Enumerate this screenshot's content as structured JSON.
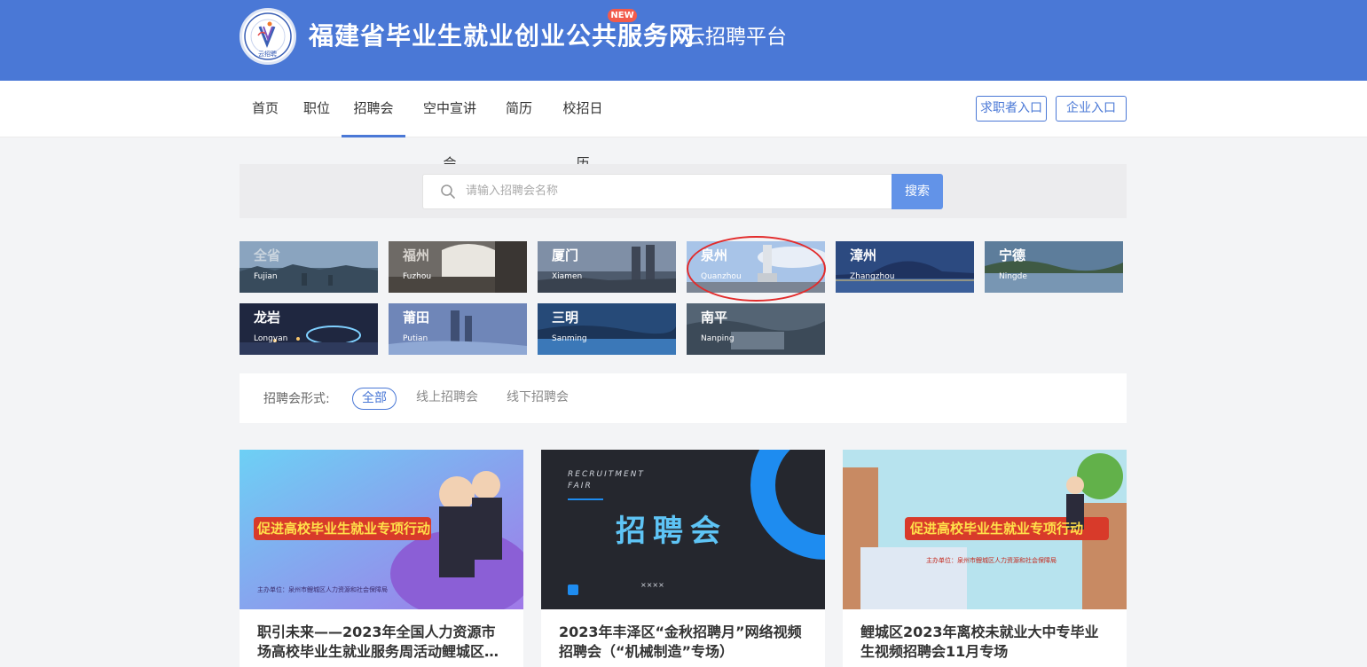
{
  "header": {
    "logo_text": "云招聘",
    "brand_main": "福建省毕业生就业创业公共服务网",
    "brand_sub": "云招聘平台"
  },
  "nav": {
    "items": [
      {
        "label": "首页"
      },
      {
        "label": "职位"
      },
      {
        "label": "招聘会"
      },
      {
        "label": "空中宣讲会"
      },
      {
        "label": "简历"
      },
      {
        "label": "校招日历"
      }
    ],
    "active_index": 2,
    "new_badge": "NEW",
    "jobseeker_btn": "求职者入口",
    "company_btn": "企业入口"
  },
  "search": {
    "placeholder": "请输入招聘会名称",
    "button": "搜索"
  },
  "cities": [
    {
      "cn": "全省",
      "en": "Fujian"
    },
    {
      "cn": "福州",
      "en": "Fuzhou"
    },
    {
      "cn": "厦门",
      "en": "Xiamen"
    },
    {
      "cn": "泉州",
      "en": "Quanzhou"
    },
    {
      "cn": "漳州",
      "en": "Zhangzhou"
    },
    {
      "cn": "宁德",
      "en": "Ningde"
    },
    {
      "cn": "龙岩",
      "en": "Longyan"
    },
    {
      "cn": "莆田",
      "en": "Putian"
    },
    {
      "cn": "三明",
      "en": "Sanming"
    },
    {
      "cn": "南平",
      "en": "Nanping"
    }
  ],
  "filter": {
    "label": "招聘会形式:",
    "options": [
      "全部",
      "线上招聘会",
      "线下招聘会"
    ],
    "active_index": 0
  },
  "cards": [
    {
      "banner_text": "促进高校毕业生就业专项行动",
      "organizer": "主办单位：泉州市鲤城区人力资源和社会保障局",
      "title": "职引未来——2023年全国人力资源市场高校毕业生就业服务周活动鲤城区…"
    },
    {
      "banner_en": "RECRUITMENT FAIR",
      "banner_text": "招聘会",
      "banner_stars": "××××",
      "title": "2023年丰泽区“金秋招聘月”网络视频招聘会（“机械制造”专场）"
    },
    {
      "banner_text": "促进高校毕业生就业专项行动",
      "organizer": "主办单位：泉州市鲤城区人力资源和社会保障局",
      "title": "鲤城区2023年离校未就业大中专毕业生视频招聘会11月专场"
    }
  ],
  "colors": {
    "brand": "#4a78d6",
    "search_button": "#6293e8",
    "new_badge": "#f25b4b",
    "highlight_circle": "#e22b2b"
  }
}
